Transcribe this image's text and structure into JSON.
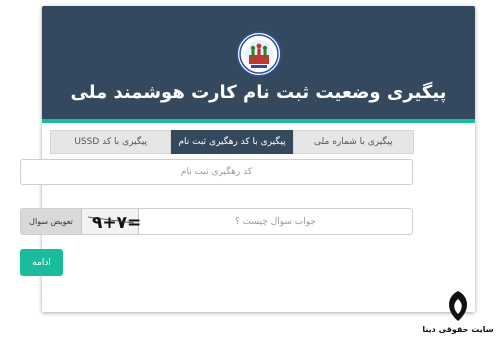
{
  "header": {
    "title": "پیگیری وضعیت ثبت نام کارت هوشمند ملی"
  },
  "tabs": [
    {
      "label": "پیگیری با شماره ملی",
      "active": false
    },
    {
      "label": "پیگیری با کد رهگیری ثبت نام",
      "active": true
    },
    {
      "label": "پیگیری با کد USSD",
      "active": false
    }
  ],
  "form": {
    "tracking_placeholder": "کد رهگیری ثبت نام",
    "captcha_answer_placeholder": "جواب سوال چیست ؟",
    "change_question_label": "تعویض سوال",
    "captcha_text": "۹+۷=",
    "continue_label": "ادامه"
  },
  "watermark": {
    "text": "سایت حقوقی دینا"
  },
  "colors": {
    "header_bg": "#34495e",
    "accent": "#1abc9c",
    "tab_active_bg": "#34495e",
    "tab_inactive_bg": "#e6e6e6",
    "button_primary": "#1abc9c"
  },
  "icons": {
    "logo": "national-registration-logo-icon",
    "watermark": "dina-legal-logo-icon"
  }
}
